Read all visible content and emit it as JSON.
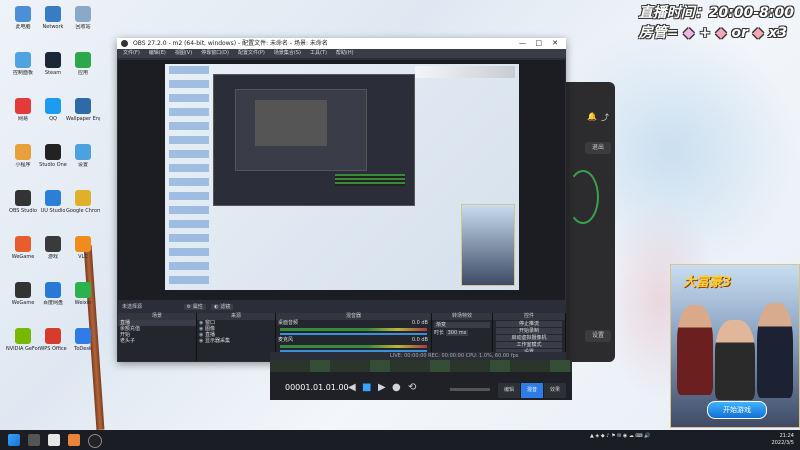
{
  "overlay": {
    "line1": "直播时间：20:00-8:00",
    "line2": "房管=",
    "line2_mid": "+",
    "line2_or": "or",
    "line2_end": "x3"
  },
  "desktop_icons": [
    {
      "label": "此电脑",
      "color": "#4a8fd8"
    },
    {
      "label": "Network",
      "color": "#3a7cc2"
    },
    {
      "label": "回收站",
      "color": "#8aa9c9"
    },
    {
      "label": "控制面板",
      "color": "#4fa3e0"
    },
    {
      "label": "Steam",
      "color": "#1b2838"
    },
    {
      "label": "应用",
      "color": "#2ca84a"
    },
    {
      "label": "网易",
      "color": "#e33b3b"
    },
    {
      "label": "QQ",
      "color": "#1d9bf0"
    },
    {
      "label": "Wallpaper Engine",
      "color": "#2c6aa8"
    },
    {
      "label": "小程序",
      "color": "#e6a13b"
    },
    {
      "label": "Studio One",
      "color": "#222"
    },
    {
      "label": "设置",
      "color": "#4aa3df"
    },
    {
      "label": "OBS Studio",
      "color": "#333"
    },
    {
      "label": "UU Studio",
      "color": "#2b7fd6"
    },
    {
      "label": "Google Chrome",
      "color": "#e0b02b"
    },
    {
      "label": "WeGame",
      "color": "#e85d2b"
    },
    {
      "label": "游戏",
      "color": "#3a3a3a"
    },
    {
      "label": "VLC",
      "color": "#f08c1c"
    },
    {
      "label": "WeGame",
      "color": "#333"
    },
    {
      "label": "百度网盘",
      "color": "#2a78d6"
    },
    {
      "label": "Weixin",
      "color": "#2bb24c"
    },
    {
      "label": "NVIDIA GeForce Experience",
      "color": "#76b900"
    },
    {
      "label": "WPS Office",
      "color": "#d63b2b"
    },
    {
      "label": "ToDesk",
      "color": "#2f7ce6"
    }
  ],
  "obs": {
    "title": "OBS 27.2.0 - m2 (64-bit, windows) - 配置文件: 未命名 - 场景: 未命名",
    "menu": [
      "文件(F)",
      "编辑(E)",
      "视图(V)",
      "停靠窗口(D)",
      "配置文件(P)",
      "场景集合(S)",
      "工具(T)",
      "帮助(H)"
    ],
    "scene_bar": "未选择源",
    "scene_bar_buttons": [
      "属性",
      "滤镜"
    ],
    "docks": {
      "scenes": {
        "title": "场景",
        "items": [
          "直播",
          "余额充值",
          "开始",
          "老头子"
        ]
      },
      "sources": {
        "title": "来源",
        "items": [
          "窗口",
          "图像",
          "直播",
          "显示器采集"
        ]
      },
      "mixer": {
        "title": "混音器",
        "channel1": "桌面音频",
        "channel1_db": "0.0 dB",
        "channel2": "麦克风",
        "channel2_db": "0.0 dB"
      },
      "transitions": {
        "title": "转场特效",
        "type": "渐变",
        "duration_label": "时长",
        "duration": "300 ms"
      },
      "controls": {
        "title": "控件",
        "buttons": [
          "停止推流",
          "开始录制",
          "启动虚拟摄像机",
          "工作室模式",
          "设置",
          "退出"
        ]
      }
    },
    "status": "LIVE: 00:00:00   REC: 00:00:00   CPU: 1.0%, 60.00 fps"
  },
  "dark2": {
    "buttons": [
      "退出",
      "设置"
    ]
  },
  "player": {
    "timecode": "00001.01.01.00",
    "tabs": [
      "编辑",
      "混音",
      "效果"
    ]
  },
  "ad": {
    "logo": "大富豪3",
    "cta": "开始游戏"
  },
  "taskbar": {
    "time": "21:24",
    "date": "2022/3/5"
  }
}
